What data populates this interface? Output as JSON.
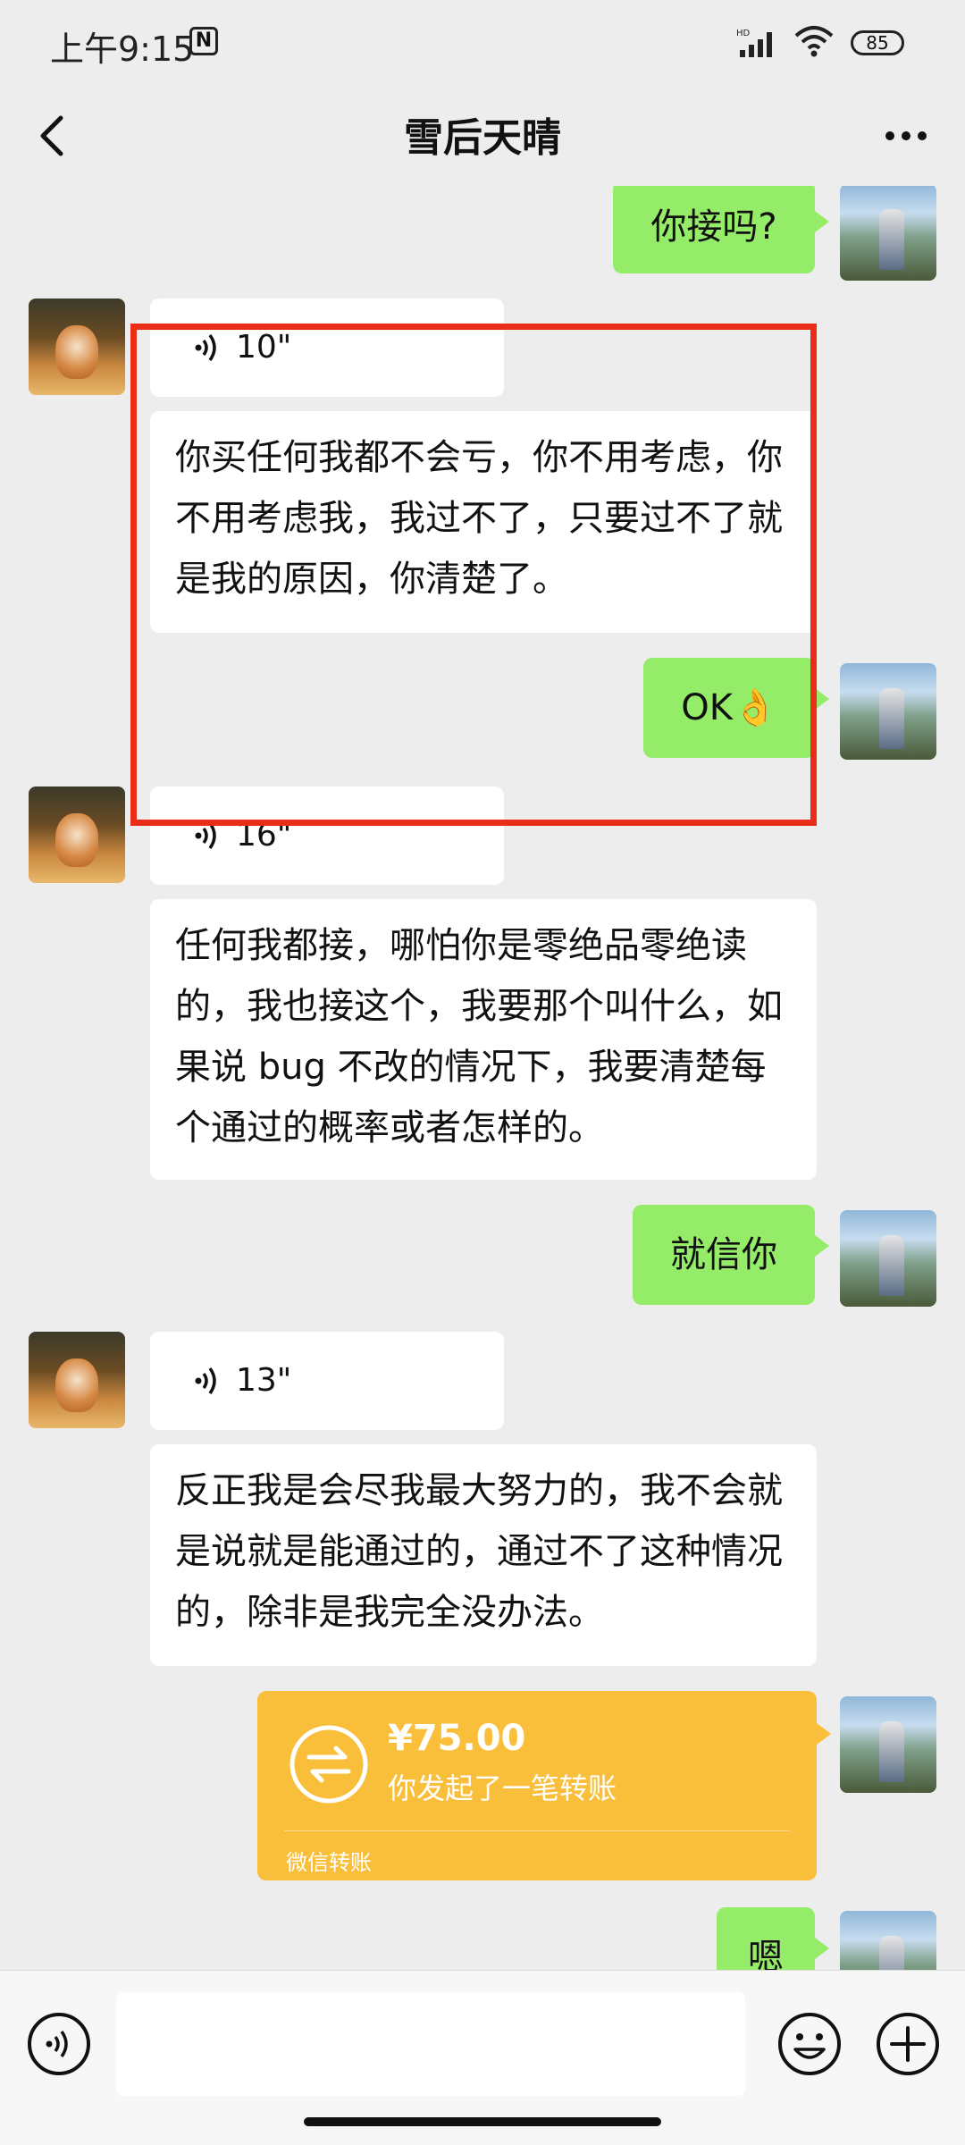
{
  "status_bar": {
    "time": "上午9:15",
    "nfc": "N",
    "signal": "HD",
    "battery": "85"
  },
  "header": {
    "title": "雪后天晴"
  },
  "messages": {
    "m1": {
      "text": "你接吗?"
    },
    "m2": {
      "duration": "10\""
    },
    "m3": {
      "text": "你买任何我都不会亏，你不用考虑，你不用考虑我，我过不了，只要过不了就是我的原因，你清楚了。"
    },
    "m4": {
      "text": "OK👌"
    },
    "m5": {
      "duration": "16\""
    },
    "m6": {
      "text": "任何我都接，哪怕你是零绝品零绝读的，我也接这个，我要那个叫什么，如果说 bug 不改的情况下，我要清楚每个通过的概率或者怎样的。"
    },
    "m7": {
      "text": "就信你"
    },
    "m8": {
      "duration": "13\""
    },
    "m9": {
      "text": "反正我是会尽我最大努力的，我不会就是说就是能通过的，通过不了这种情况的，除非是我完全没办法。"
    },
    "transfer": {
      "amount": "¥75.00",
      "desc": "你发起了一笔转账",
      "brand": "微信转账"
    },
    "m10": {
      "text": "嗯"
    }
  },
  "colors": {
    "sent_bubble": "#95ec69",
    "received_bubble": "#ffffff",
    "transfer": "#f9bf3b",
    "highlight": "#ea2d16"
  }
}
